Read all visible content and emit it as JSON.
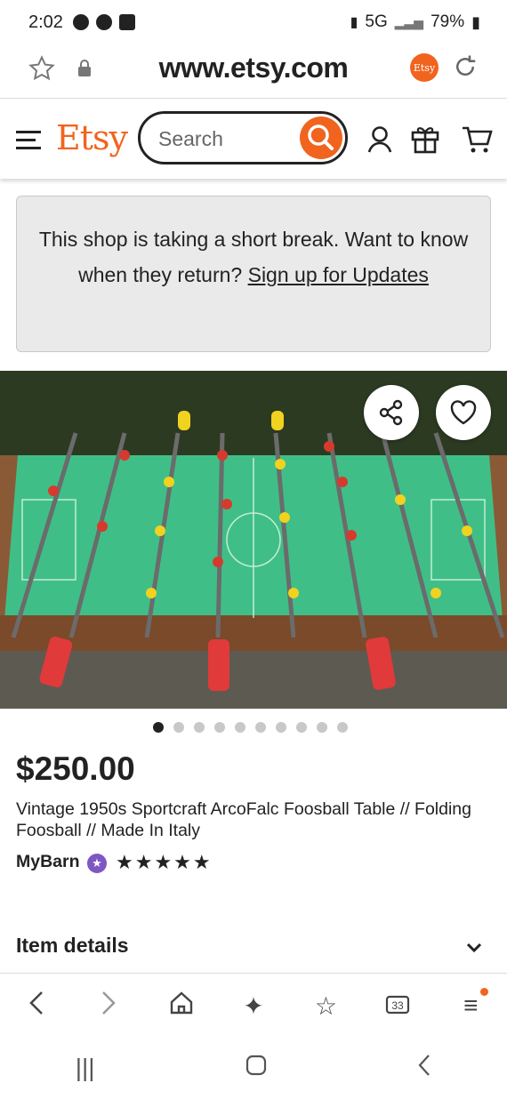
{
  "status": {
    "time": "2:02",
    "network": "5G",
    "battery": "79%"
  },
  "browser": {
    "url": "www.etsy.com",
    "ext_label": "Etsy"
  },
  "header": {
    "logo": "Etsy",
    "search_placeholder": "Search"
  },
  "notice": {
    "text": "This shop is taking a short break. Want to know when they return?",
    "link": "Sign up for Updates"
  },
  "gallery": {
    "total": 10,
    "active": 1
  },
  "listing": {
    "price": "$250.00",
    "title": "Vintage 1950s Sportcraft ArcoFalc Foosball Table // Folding Foosball // Made In Italy",
    "shop": "MyBarn",
    "rating_stars": "★★★★★"
  },
  "sections": {
    "details": "Item details"
  },
  "colors": {
    "brand": "#f1641e",
    "field": "#3fbf87"
  }
}
